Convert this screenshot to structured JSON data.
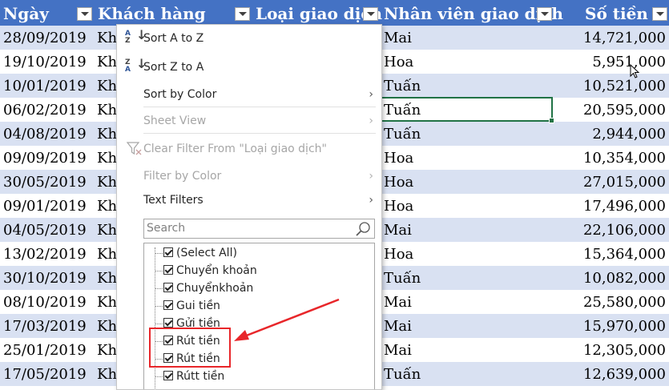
{
  "table": {
    "headers": {
      "date": "Ngày",
      "customer": "Khách hàng",
      "type": "Loại giao dịch",
      "staff": "Nhân viên giao dịch",
      "amount": "Số tiền"
    },
    "rows": [
      {
        "date": "28/09/2019",
        "customer": "Kh",
        "staff": "Mai",
        "amount": "14,721,000"
      },
      {
        "date": "19/10/2019",
        "customer": "Kh",
        "staff": "Hoa",
        "amount": "5,951,000"
      },
      {
        "date": "10/01/2019",
        "customer": "Kh",
        "staff": "Tuấn",
        "amount": "10,521,000"
      },
      {
        "date": "06/02/2019",
        "customer": "Kh",
        "staff": "Tuấn",
        "amount": "20,595,000"
      },
      {
        "date": "04/08/2019",
        "customer": "Kh",
        "staff": "Tuấn",
        "amount": "2,944,000"
      },
      {
        "date": "09/09/2019",
        "customer": "Kh",
        "staff": "Hoa",
        "amount": "10,354,000"
      },
      {
        "date": "30/05/2019",
        "customer": "Kh",
        "staff": "Hoa",
        "amount": "27,015,000"
      },
      {
        "date": "09/01/2019",
        "customer": "Kh",
        "staff": "Hoa",
        "amount": "17,496,000"
      },
      {
        "date": "04/05/2019",
        "customer": "Kh",
        "staff": "Mai",
        "amount": "22,106,000"
      },
      {
        "date": "13/02/2019",
        "customer": "Kh",
        "staff": "Hoa",
        "amount": "15,364,000"
      },
      {
        "date": "30/10/2019",
        "customer": "Kh",
        "staff": "Tuấn",
        "amount": "10,082,000"
      },
      {
        "date": "08/10/2019",
        "customer": "Kh",
        "staff": "Mai",
        "amount": "25,580,000"
      },
      {
        "date": "17/03/2019",
        "customer": "Kh",
        "staff": "Mai",
        "amount": "15,970,000"
      },
      {
        "date": "25/01/2019",
        "customer": "Kh",
        "staff": "Mai",
        "amount": "12,305,000"
      },
      {
        "date": "17/05/2019",
        "customer": "Kh",
        "staff": "Tuấn",
        "amount": "12,639,000"
      }
    ]
  },
  "menu": {
    "sort_az": "Sort A to Z",
    "sort_za": "Sort Z to A",
    "sort_by_color": "Sort by Color",
    "sheet_view": "Sheet View",
    "clear_filter": "Clear Filter From \"Loại giao dịch\"",
    "filter_by_color": "Filter by Color",
    "text_filters": "Text Filters",
    "search_placeholder": "Search",
    "items": [
      {
        "label": "(Select All)",
        "checked": true
      },
      {
        "label": "Chuyển khoản",
        "checked": true
      },
      {
        "label": "Chuyểnkhoản",
        "checked": true
      },
      {
        "label": "Gui tiền",
        "checked": true
      },
      {
        "label": "Gửi tiền",
        "checked": true
      },
      {
        "label": "Rút  tiền",
        "checked": true
      },
      {
        "label": "Rút tiền",
        "checked": true
      },
      {
        "label": "Rútt tiền",
        "checked": true
      }
    ]
  },
  "colors": {
    "header_bg": "#4472c4",
    "band_bg": "#d9e1f2",
    "selection": "#217346",
    "annotation": "#e8262a"
  }
}
